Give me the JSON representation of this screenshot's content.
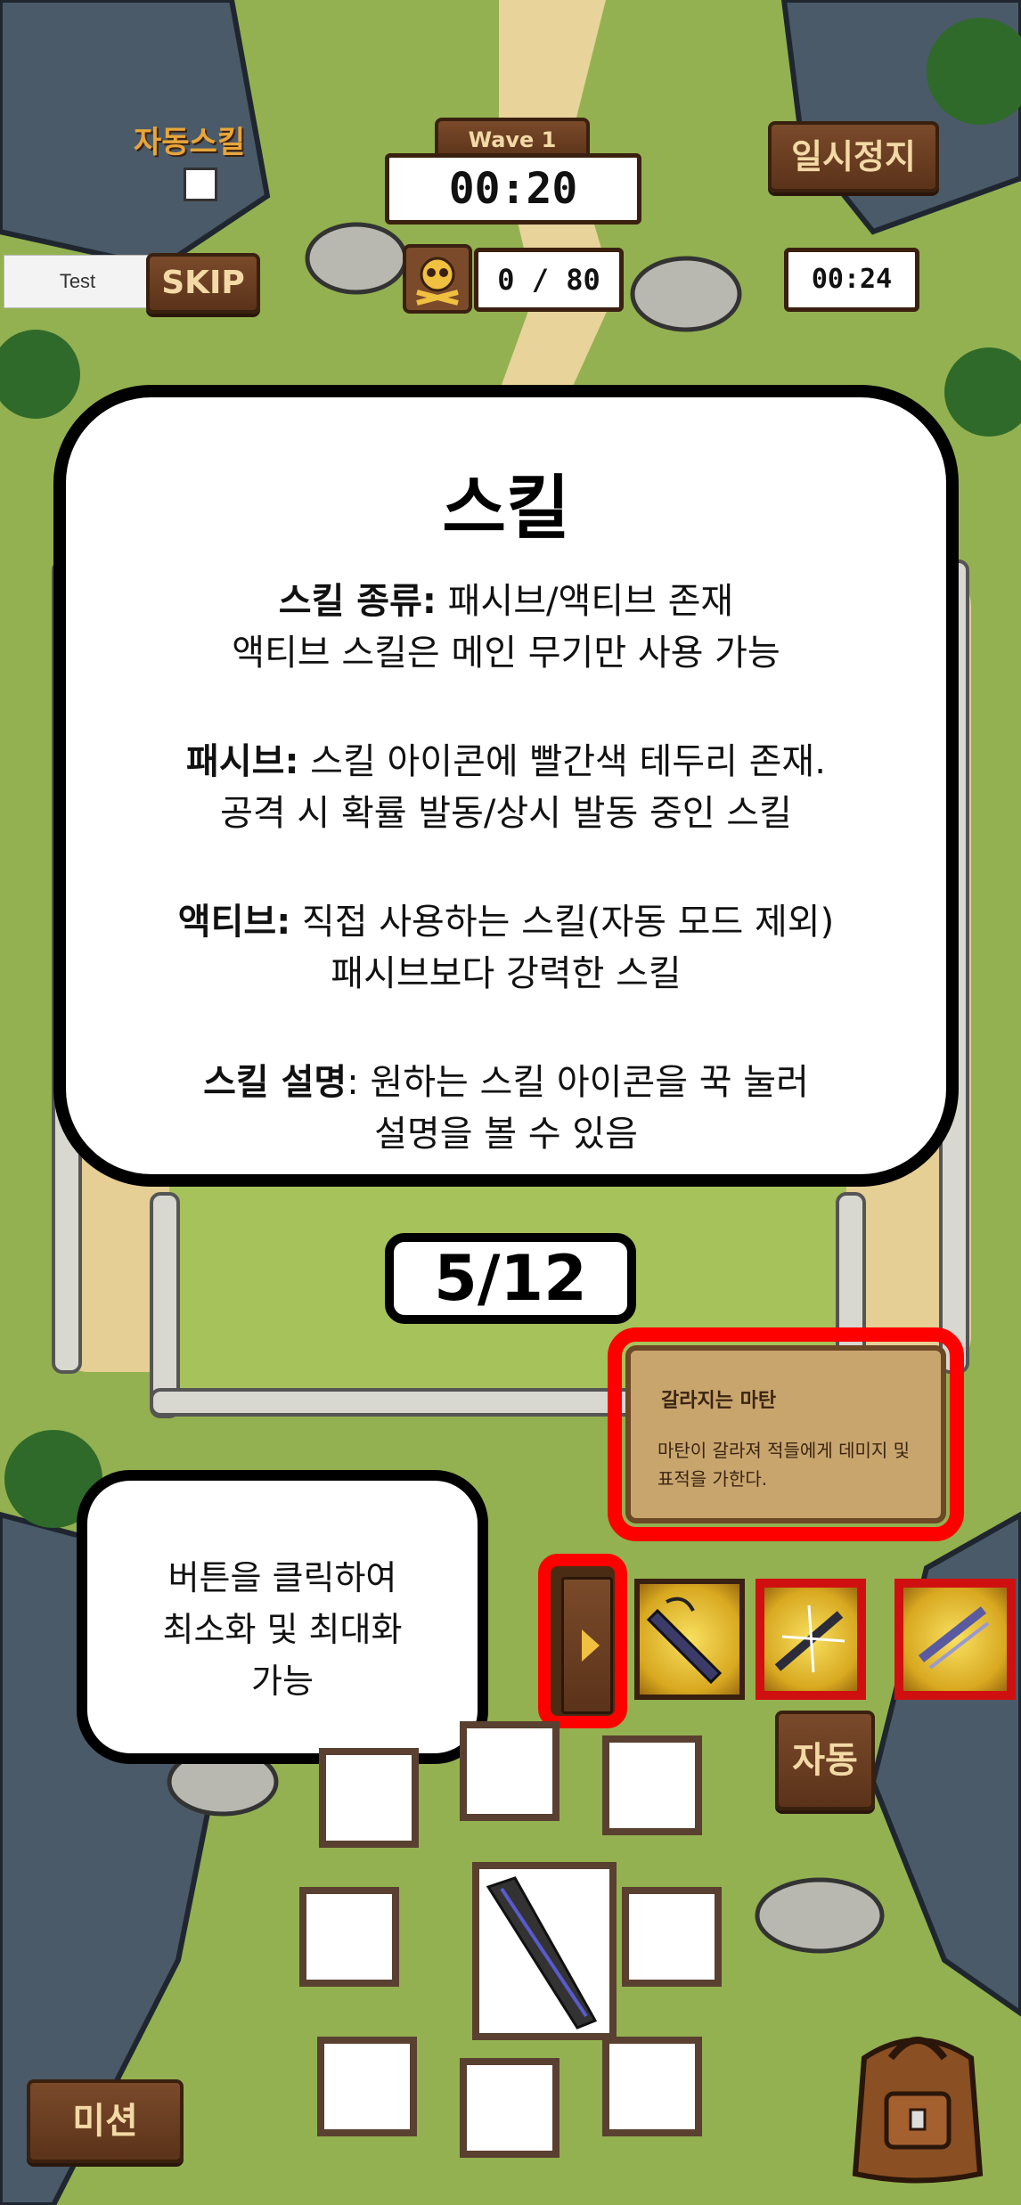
{
  "hud": {
    "auto_skill_label": "자동스킬",
    "wave_label": "Wave 1",
    "wave_timer": "00:20",
    "pause_label": "일시정지",
    "test_button": "Test",
    "skip_button": "SKIP",
    "kill_count": "0 / 80",
    "side_timer": "00:24"
  },
  "tutorial": {
    "title": "스킬",
    "paragraphs": [
      {
        "bold": "스킬 종류:",
        "line1": " 패시브/액티브 존재",
        "line2": "액티브 스킬은 메인 무기만 사용 가능"
      },
      {
        "bold": "패시브:",
        "line1": " 스킬 아이콘에 빨간색 테두리 존재.",
        "line2": "공격 시 확률 발동/상시 발동 중인 스킬"
      },
      {
        "bold": "액티브:",
        "line1": " 직접 사용하는 스킬(자동 모드 제외)",
        "line2": "패시브보다 강력한 스킬"
      },
      {
        "bold": "스킬 설명",
        "line1": ": 원하는 스킬 아이콘을 꾹 눌러",
        "line2": "설명을 볼 수 있음"
      }
    ],
    "page": "5/12"
  },
  "tooltip": {
    "name": "갈라지는 마탄",
    "desc": "마탄이 갈라져 적들에게 데미지 및 표적을 가한다."
  },
  "hint": {
    "lines": [
      "버튼을 클릭하여",
      "최소화 및 최대화",
      "가능"
    ]
  },
  "bottom": {
    "auto_button": "자동",
    "mission_button": "미션"
  },
  "icons": {
    "toggle": "chevron-right-icon",
    "skull": "skull-icon",
    "backpack": "backpack-icon",
    "weapon": "gun-icon"
  },
  "colors": {
    "highlight": "#ff0000",
    "wood": "#6b3d1f",
    "grass": "#8fae4c"
  }
}
